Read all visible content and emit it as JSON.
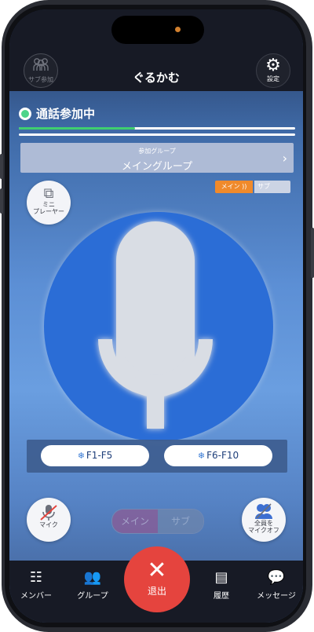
{
  "header": {
    "title": "ぐるかむ",
    "sub_join_label": "サブ参加",
    "settings_label": "設定"
  },
  "call": {
    "status": "通話参加中",
    "progress": 0.42
  },
  "group": {
    "caption": "参加グループ",
    "name": "メイングループ"
  },
  "mode_tabs": {
    "main": "メイン",
    "sub": "サブ"
  },
  "mini_player_label": "ミニ\nプレーヤー",
  "function_keys": {
    "left": "F1-F5",
    "right": "F6-F10"
  },
  "mic_button_label": "マイク",
  "mute_all_label": "全員を\nマイクオフ",
  "channel_toggle": {
    "main": "メイン",
    "sub": "サブ"
  },
  "nav": {
    "members": "メンバー",
    "groups": "グループ",
    "exit": "退出",
    "history": "履歴",
    "messages": "メッセージ"
  },
  "colors": {
    "accent_orange": "#f08a2b",
    "exit_red": "#e5443e",
    "status_green": "#4cd48a",
    "circle_blue": "#2b6dd6"
  }
}
